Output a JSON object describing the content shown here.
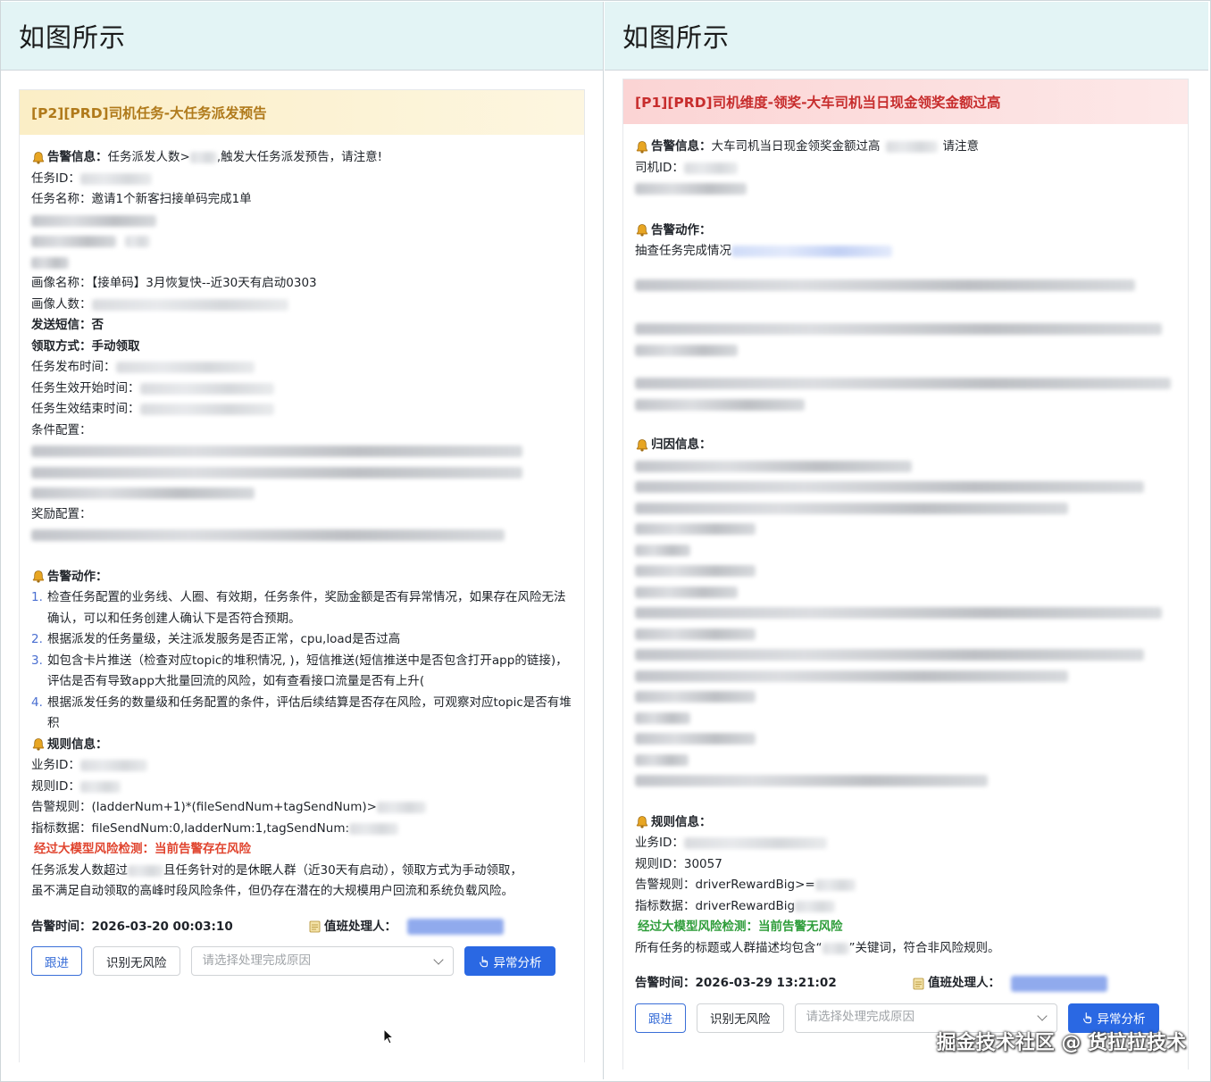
{
  "left": {
    "header": "如图所示",
    "title": "[P2][PRD]司机任务-大任务派发预告",
    "alert_info_label": "告警信息：",
    "alert_info_prefix": "任务派发人数>",
    "alert_info_suffix": ",触发大任务派发预告，请注意!",
    "task_id_label": "任务ID：",
    "task_name": "任务名称：邀请1个新客扫接单码完成1单",
    "portrait_name": "画像名称：【接单码】3月恢复快--近30天有启动0303",
    "portrait_count_label": "画像人数：",
    "send_sms": "发送短信：否",
    "claim_method": "领取方式：手动领取",
    "publish_time_label": "任务发布时间：",
    "effective_start_label": "任务生效开始时间：",
    "effective_end_label": "任务生效结束时间：",
    "condition_label": "条件配置：",
    "reward_label": "奖励配置：",
    "alert_action_label": "告警动作：",
    "actions": [
      {
        "num": "1.",
        "text": "检查任务配置的业务线、人圈、有效期，任务条件，奖励金额是否有异常情况，如果存在风险无法确认，可以和任务创建人确认下是否符合预期。"
      },
      {
        "num": "2.",
        "text": "根据派发的任务量级，关注派发服务是否正常，cpu,load是否过高"
      },
      {
        "num": "3.",
        "text": "如包含卡片推送（检查对应topic的堆积情况,                              )，短信推送(短信推送中是否包含打开app的链接)，评估是否有导致app大批量回流的风险，如有查看接口流量是否有上升("
      },
      {
        "num": "4.",
        "text": "根据派发任务的数量级和任务配置的条件，评估后续结算是否存在风险，可观察对应topic是否有堆积"
      }
    ],
    "rule_info_label": "规则信息：",
    "biz_id_label": "业务ID：",
    "rule_id_label": "规则ID：",
    "alert_rule": "告警规则：(ladderNum+1)*(fileSendNum+tagSendNum)>",
    "metric_data": "指标数据：fileSendNum:0,ladderNum:1,tagSendNum:",
    "llm_check_label": "经过大模型风险检测：",
    "llm_check_result": "当前告警存在风险",
    "llm_desc_1a": "任务派发人数超过",
    "llm_desc_1b": "且任务针对的是休眠人群（近30天有启动），领取方式为手动领取，",
    "llm_desc_2": "虽不满足自动领取的高峰时段风险条件，但仍存在潜在的大规模用户回流和系统负载风险。",
    "alert_time": "告警时间：2026-03-20 00:03:10",
    "on_duty_label": "值班处理人：",
    "btn_follow": "跟进",
    "btn_no_risk": "识别无风险",
    "select_placeholder": "请选择处理完成原因",
    "btn_analyze": "异常分析"
  },
  "right": {
    "header": "如图所示",
    "title": "[P1][PRD]司机维度-领奖-大车司机当日现金领奖金额过高",
    "alert_info_label": "告警信息：",
    "alert_info_prefix": "大车司机当日现金领奖金额过高",
    "alert_info_suffix": "请注意",
    "driver_id_label": "司机ID：",
    "alert_action_label": "告警动作：",
    "alert_action_text": "抽查任务完成情况",
    "attribution_label": "归因信息：",
    "rule_info_label": "规则信息：",
    "biz_id_label": "业务ID：",
    "rule_id": "规则ID：30057",
    "alert_rule": "告警规则：driverRewardBig>=",
    "metric_data": "指标数据：driverRewardBig",
    "llm_check_label": "经过大模型风险检测：",
    "llm_check_result": "当前告警无风险",
    "llm_desc_a": "所有任务的标题或人群描述均包含“",
    "llm_desc_b": "”关键词，符合非风险规则。",
    "alert_time": "告警时间：2026-03-29 13:21:02",
    "on_duty_label": "值班处理人：",
    "btn_follow": "跟进",
    "btn_no_risk": "识别无风险",
    "select_placeholder": "请选择处理完成原因",
    "btn_analyze": "异常分析"
  },
  "watermark": "掘金技术社区 @ 货拉拉技术",
  "colors": {
    "header_bg": "#e3f4f5",
    "p2_title": "#b07a1b",
    "p1_title": "#c72d2d",
    "risk_red": "#e0442e",
    "risk_green": "#2e9d3a",
    "primary": "#2a68e3"
  }
}
